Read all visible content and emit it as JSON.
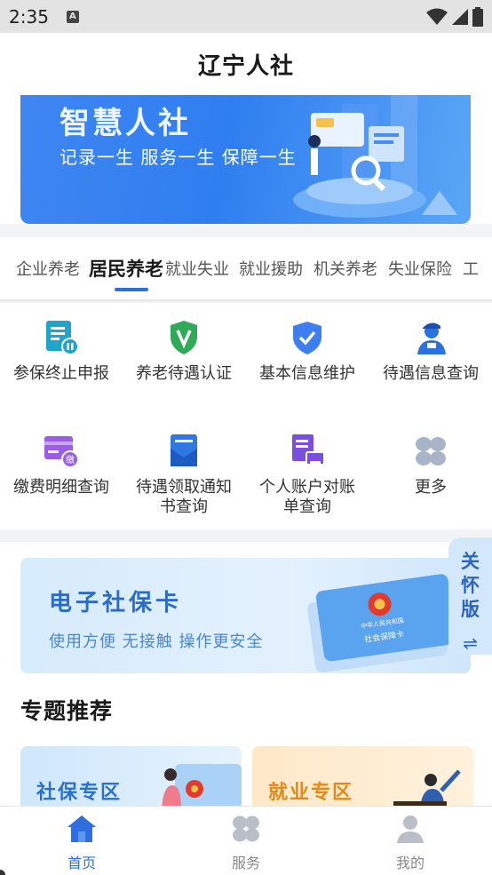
{
  "status_bar": {
    "time": "2:35"
  },
  "header": {
    "title": "辽宁人社"
  },
  "banner": {
    "title": "智慧人社",
    "subtitle": "记录一生  服务一生  保障一生"
  },
  "tabs": [
    {
      "label": "企业养老",
      "active": false
    },
    {
      "label": "居民养老",
      "active": true
    },
    {
      "label": "就业失业",
      "active": false
    },
    {
      "label": "就业援助",
      "active": false
    },
    {
      "label": "机关养老",
      "active": false
    },
    {
      "label": "失业保险",
      "active": false
    },
    {
      "label": "工",
      "active": false
    }
  ],
  "services": [
    {
      "label": "参保终止申报",
      "icon": "document-pause-icon"
    },
    {
      "label": "养老待遇认证",
      "icon": "shield-v-icon"
    },
    {
      "label": "基本信息维护",
      "icon": "shield-check-icon"
    },
    {
      "label": "待遇信息查询",
      "icon": "person-cap-icon"
    },
    {
      "label": "缴费明细查询",
      "icon": "payment-card-icon"
    },
    {
      "label": "待遇领取通知书查询",
      "icon": "envelope-icon"
    },
    {
      "label": "个人账户对账单查询",
      "icon": "printer-document-icon"
    },
    {
      "label": "更多",
      "icon": "more-grid-icon"
    }
  ],
  "ecard": {
    "title": "电子社保卡",
    "subtitle": "使用方便 无接触 操作更安全",
    "card_text_top": "中华人民共和国",
    "card_text_bottom": "社会保障卡"
  },
  "care_mode": {
    "label": "关怀版",
    "swap_glyph": "⇌"
  },
  "section": {
    "title": "专题推荐"
  },
  "topics": [
    {
      "label": "社保专区"
    },
    {
      "label": "就业专区"
    }
  ],
  "bottom_nav": [
    {
      "label": "首页",
      "active": true
    },
    {
      "label": "服务",
      "active": false
    },
    {
      "label": "我的",
      "active": false
    }
  ],
  "colors": {
    "primary": "#2d6fe0",
    "banner": "#3f86f2",
    "active_tab_underline": "#2d6fe0"
  }
}
